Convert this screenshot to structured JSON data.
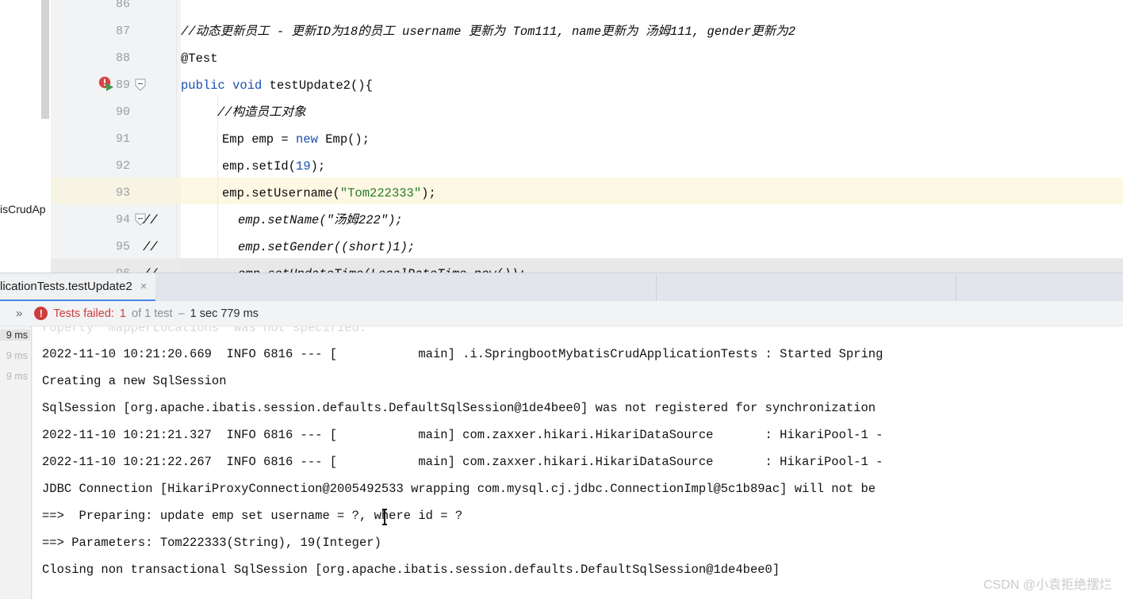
{
  "editor": {
    "scrollbar": {
      "name": "editor-vertical-scrollbar"
    },
    "left_stripe_label": "isCrudAp",
    "lines": [
      {
        "number": "86",
        "code": "",
        "state": "normal"
      },
      {
        "number": "87",
        "code": "//动态更新员工 - 更新ID为18的员工 username 更新为 Tom111, name更新为 汤姆111, gender更新为2",
        "state": "normal"
      },
      {
        "number": "88",
        "code": "@Test",
        "state": "normal"
      },
      {
        "number": "89",
        "code": "public void testUpdate2(){",
        "state": "normal"
      },
      {
        "number": "90",
        "code": "    //构造员工对象",
        "state": "normal"
      },
      {
        "number": "91",
        "code": "    Emp emp = new Emp();",
        "state": "normal"
      },
      {
        "number": "92",
        "code": "    emp.setId(19);",
        "state": "normal"
      },
      {
        "number": "93",
        "code": "    emp.setUsername(\"Tom222333\");",
        "state": "caret"
      },
      {
        "number": "94",
        "code": "//        emp.setName(\"汤姆222\");",
        "state": "normal"
      },
      {
        "number": "95",
        "code": "//        emp.setGender((short)1);",
        "state": "normal"
      },
      {
        "number": "96",
        "code": "//        emp.setUpdateTime(LocalDateTime.now());",
        "state": "selected"
      }
    ],
    "gutter_icons": {
      "error_run_icon": "error-run-gutter-icon",
      "fold_collapse_icon": "fold-collapse-icon"
    },
    "colors": {
      "comment": "#adb6bf",
      "keyword": "#1b4fae",
      "annotation": "#c8a520",
      "string": "#2a7a2a",
      "caret_line": "#fdf8e3",
      "selected_line": "#e8e8e8"
    }
  },
  "run_window": {
    "tab": {
      "label": "licationTests.testUpdate2",
      "close_icon": "×",
      "accent": "#4a86e8"
    },
    "status": {
      "expand_icon": "»",
      "error_badge": "!",
      "failed_label": "Tests failed:",
      "failed_count": "1",
      "of_label": "of 1 test",
      "dash": "–",
      "duration": "1 sec 779 ms"
    },
    "timings": [
      {
        "value": "9 ms",
        "emphasis": "strong"
      },
      {
        "value": "9 ms",
        "emphasis": "dim"
      },
      {
        "value": "9 ms",
        "emphasis": "dim"
      }
    ],
    "console_lines": [
      "roperty 'mapperLocations' was not specified.",
      "2022-11-10 10:21:20.669  INFO 6816 --- [           main] .i.SpringbootMybatisCrudApplicationTests : Started Spring",
      "Creating a new SqlSession",
      "SqlSession [org.apache.ibatis.session.defaults.DefaultSqlSession@1de4bee0] was not registered for synchronization",
      "2022-11-10 10:21:21.327  INFO 6816 --- [           main] com.zaxxer.hikari.HikariDataSource       : HikariPool-1 -",
      "2022-11-10 10:21:22.267  INFO 6816 --- [           main] com.zaxxer.hikari.HikariDataSource       : HikariPool-1 -",
      "JDBC Connection [HikariProxyConnection@2005492533 wrapping com.mysql.cj.jdbc.ConnectionImpl@5c1b89ac] will not be",
      "==>  Preparing: update emp set username = ?, where id = ?",
      "==> Parameters: Tom222333(String), 19(Integer)",
      "Closing non transactional SqlSession [org.apache.ibatis.session.defaults.DefaultSqlSession@1de4bee0]"
    ]
  },
  "watermark": {
    "text": "CSDN @小袁拒绝摆烂"
  }
}
